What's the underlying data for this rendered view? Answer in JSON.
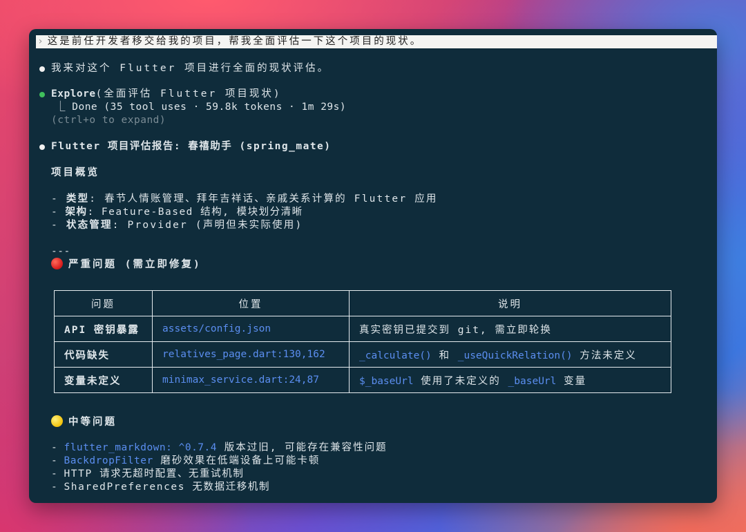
{
  "prompt": {
    "chevron": "›",
    "text": "这是前任开发者移交给我的项目，帮我全面评估一下这个项目的现状。"
  },
  "intro": "我来对这个 Flutter 项目进行全面的现状评估。",
  "explore": {
    "name": "Explore",
    "args": "(全面评估 Flutter 项目现状)",
    "result_prefix": "⎿ ",
    "result": "Done (35 tool uses · 59.8k tokens · 1m 29s)",
    "hint": "(ctrl+o to expand)"
  },
  "report": {
    "title": "Flutter 项目评估报告: 春禧助手 (spring_mate)",
    "overview_heading": "项目概览",
    "overview": [
      {
        "key": "类型",
        "value": ": 春节人情账管理、拜年吉祥话、亲戚关系计算的 Flutter 应用"
      },
      {
        "key": "架构",
        "value": ": Feature-Based 结构, 模块划分清晰"
      },
      {
        "key": "状态管理",
        "value": ": Provider (声明但未实际使用)"
      }
    ],
    "separator": "---",
    "severe_heading": "严重问题 (需立即修复)",
    "table": {
      "headers": [
        "问题",
        "位置",
        "说明"
      ],
      "rows": [
        {
          "issue": "API 密钥暴露",
          "location": "assets/config.json",
          "desc_a": "真实密钥已提交到 git, 需立即轮换",
          "desc_code1": "",
          "desc_b": "",
          "desc_code2": "",
          "desc_c": ""
        },
        {
          "issue": "代码缺失",
          "location": "relatives_page.dart:130,162",
          "desc_a": "",
          "desc_code1": "_calculate()",
          "desc_b": " 和 ",
          "desc_code2": "_useQuickRelation()",
          "desc_c": " 方法未定义"
        },
        {
          "issue": "变量未定义",
          "location": "minimax_service.dart:24,87",
          "desc_a": "",
          "desc_code1": "$_baseUrl",
          "desc_b": " 使用了未定义的 ",
          "desc_code2": "_baseUrl",
          "desc_c": " 变量"
        }
      ]
    },
    "medium_heading": "中等问题",
    "medium": [
      {
        "code": "flutter_markdown: ^0.7.4",
        "text": " 版本过旧, 可能存在兼容性问题"
      },
      {
        "code": "BackdropFilter",
        "text": " 磨砂效果在低端设备上可能卡顿"
      },
      {
        "code": "",
        "text": "HTTP 请求无超时配置、无重试机制"
      },
      {
        "code": "",
        "text": "SharedPreferences 无数据迁移机制"
      }
    ]
  },
  "colors": {
    "terminal_bg": "#0f2c3b",
    "text": "#dfe6ea",
    "code_blue": "#5b8ef0",
    "dim": "#7b8c95",
    "status_green": "#3fbf5c"
  }
}
